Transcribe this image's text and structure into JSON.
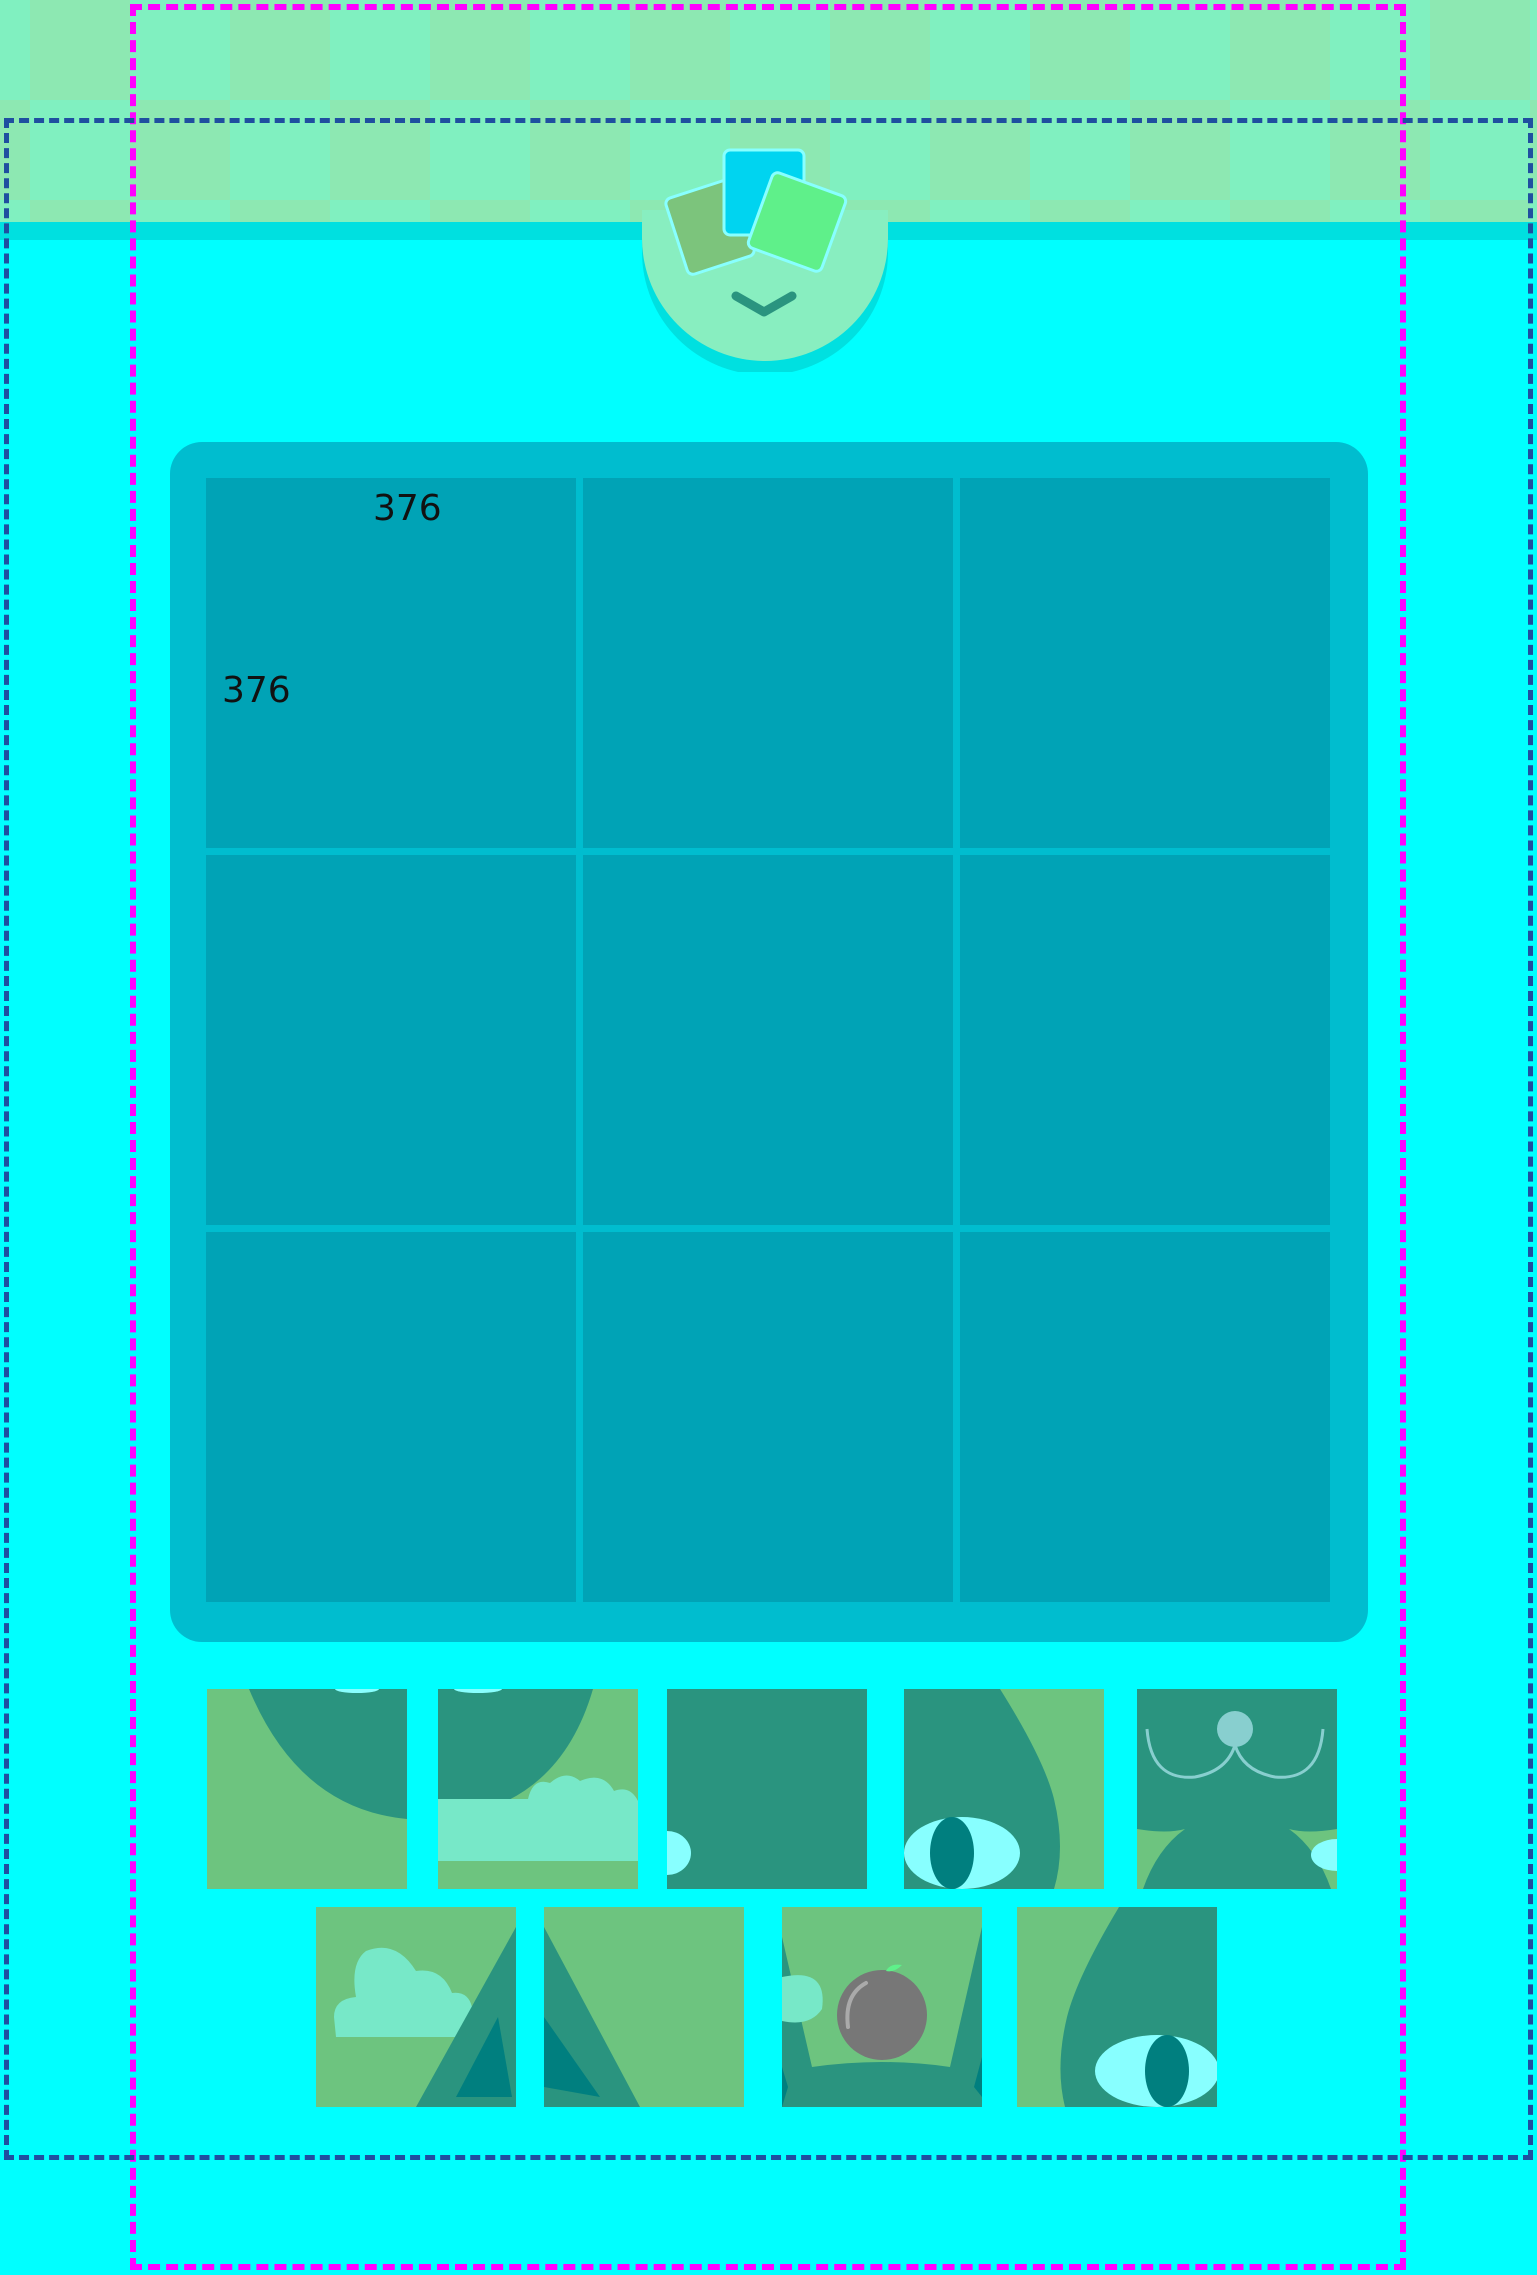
{
  "board": {
    "rows": 3,
    "cols": 3,
    "labels": {
      "top": "376",
      "left": "376"
    }
  },
  "menu": {
    "toggle_icon": "chevron-down-icon",
    "logo_icon": "stacked-cards-icon"
  },
  "tray": {
    "row1": [
      "piece-1",
      "piece-2",
      "piece-3",
      "piece-4",
      "piece-5"
    ],
    "row2": [
      "piece-6",
      "piece-7",
      "piece-8",
      "piece-9"
    ]
  },
  "colors": {
    "background": "#00ffff",
    "board_frame": "#00bdcf",
    "board_cell": "#00a3b6",
    "grass": "#6dc47f",
    "cat": "#2a947f",
    "cloud": "#77e8c8",
    "eye": "#88ffff",
    "pupil": "#007f7f"
  }
}
